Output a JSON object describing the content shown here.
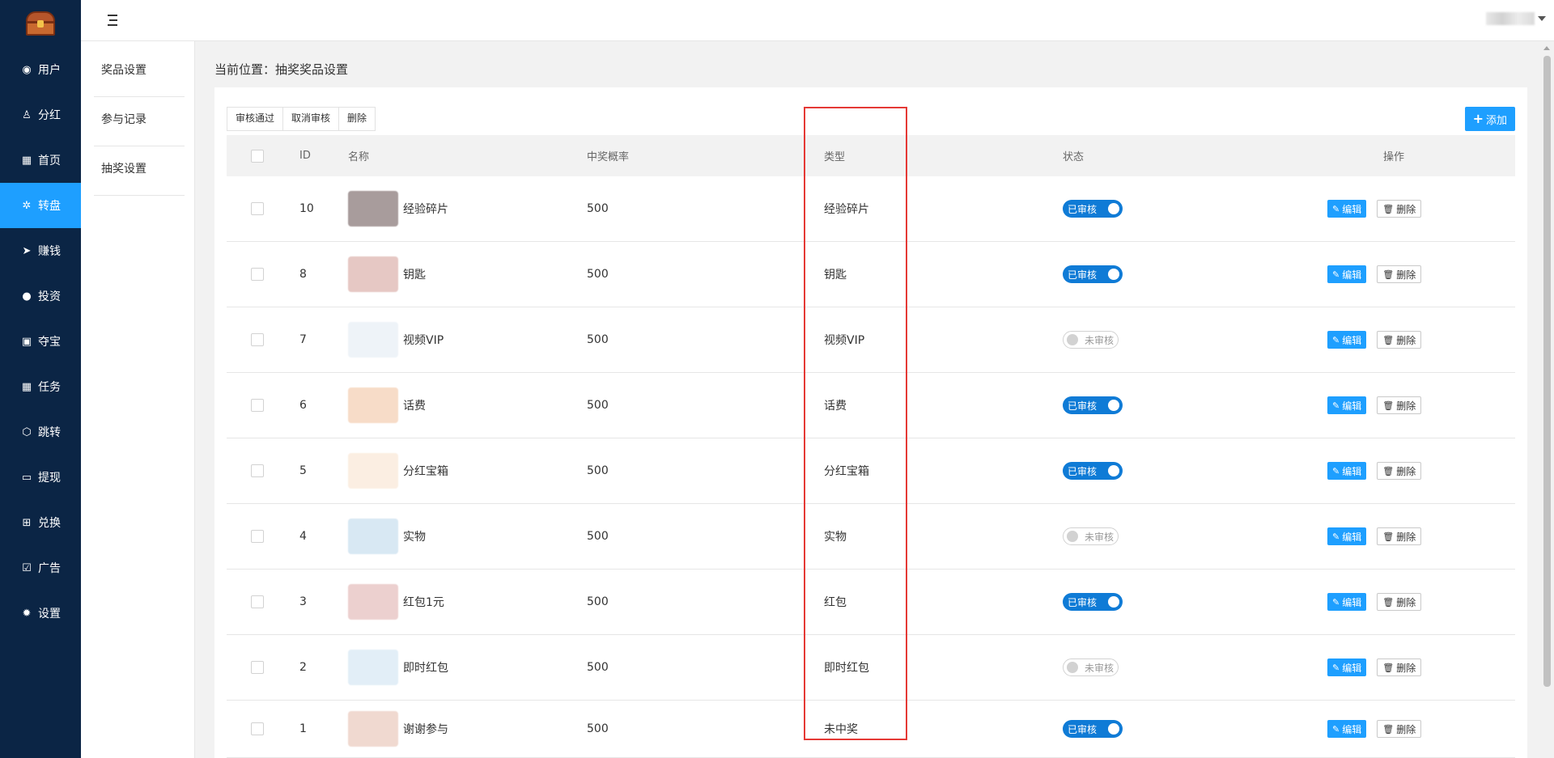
{
  "sidebar": {
    "items": [
      {
        "icon": "user-circle-icon",
        "glyph": "◉",
        "label": "用户",
        "active": false
      },
      {
        "icon": "users-icon",
        "glyph": "♙",
        "label": "分红",
        "active": false
      },
      {
        "icon": "grid-icon",
        "glyph": "▦",
        "label": "首页",
        "active": false
      },
      {
        "icon": "wheel-icon",
        "glyph": "✲",
        "label": "转盘",
        "active": true
      },
      {
        "icon": "send-icon",
        "glyph": "➤",
        "label": "赚钱",
        "active": false
      },
      {
        "icon": "coin-icon",
        "glyph": "●",
        "label": "投资",
        "active": false
      },
      {
        "icon": "gift-icon",
        "glyph": "▣",
        "label": "夺宝",
        "active": false
      },
      {
        "icon": "grid-icon",
        "glyph": "▦",
        "label": "任务",
        "active": false
      },
      {
        "icon": "cube-icon",
        "glyph": "⬡",
        "label": "跳转",
        "active": false
      },
      {
        "icon": "card-icon",
        "glyph": "▭",
        "label": "提现",
        "active": false
      },
      {
        "icon": "gift-box-icon",
        "glyph": "⊞",
        "label": "兑换",
        "active": false
      },
      {
        "icon": "check-board-icon",
        "glyph": "☑",
        "label": "广告",
        "active": false
      },
      {
        "icon": "gear-icon",
        "glyph": "✹",
        "label": "设置",
        "active": false
      }
    ]
  },
  "submenu": {
    "items": [
      "奖品设置",
      "参与记录",
      "抽奖设置"
    ]
  },
  "breadcrumb": "当前位置：抽奖奖品设置",
  "toolbar": {
    "approve_label": "审核通过",
    "cancel_approve_label": "取消审核",
    "delete_label": "删除",
    "add_label": "添加"
  },
  "table": {
    "headers": {
      "id": "ID",
      "name": "名称",
      "rate": "中奖概率",
      "type": "类型",
      "status": "状态",
      "ops": "操作"
    },
    "edit_label": "编辑",
    "delete_label": "删除",
    "rows": [
      {
        "id": "10",
        "name": "经验碎片",
        "rate": "500",
        "type": "经验碎片",
        "status": "已审核",
        "approved": true,
        "thumb": "#a89c9c"
      },
      {
        "id": "8",
        "name": "钥匙",
        "rate": "500",
        "type": "钥匙",
        "status": "已审核",
        "approved": true,
        "thumb": "#e6c8c4"
      },
      {
        "id": "7",
        "name": "视频VIP",
        "rate": "500",
        "type": "视频VIP",
        "status": "未审核",
        "approved": false,
        "thumb": "#eef3f8"
      },
      {
        "id": "6",
        "name": "话费",
        "rate": "500",
        "type": "话费",
        "status": "已审核",
        "approved": true,
        "thumb": "#f7dcc8"
      },
      {
        "id": "5",
        "name": "分红宝箱",
        "rate": "500",
        "type": "分红宝箱",
        "status": "已审核",
        "approved": true,
        "thumb": "#fbeee2"
      },
      {
        "id": "4",
        "name": "实物",
        "rate": "500",
        "type": "实物",
        "status": "未审核",
        "approved": false,
        "thumb": "#d8e8f3"
      },
      {
        "id": "3",
        "name": "红包1元",
        "rate": "500",
        "type": "红包",
        "status": "已审核",
        "approved": true,
        "thumb": "#ecd0cf"
      },
      {
        "id": "2",
        "name": "即时红包",
        "rate": "500",
        "type": "即时红包",
        "status": "未审核",
        "approved": false,
        "thumb": "#e2eef7"
      },
      {
        "id": "1",
        "name": "谢谢参与",
        "rate": "500",
        "type": "未中奖",
        "status": "已审核",
        "approved": true,
        "thumb": "#f0d9d0"
      }
    ]
  },
  "colors": {
    "sidebar_bg": "#0b2545",
    "accent": "#1e9fff",
    "switch_on": "#0f7bd6",
    "highlight": "#e53935"
  }
}
